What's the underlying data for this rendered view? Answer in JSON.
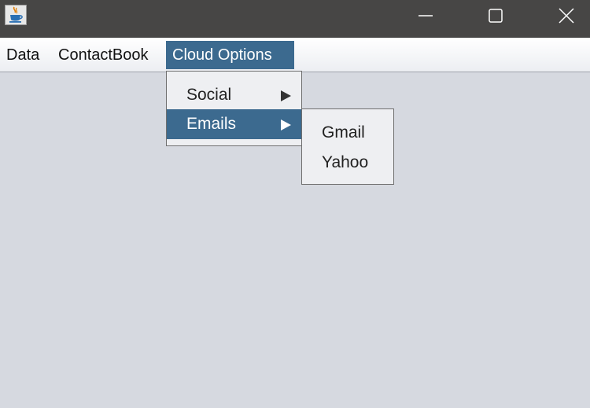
{
  "window": {
    "app_icon": "java-coffee-cup-icon",
    "controls": [
      "minimize-icon",
      "maximize-icon",
      "close-icon"
    ]
  },
  "menubar": {
    "menus": [
      "Data",
      "ContactBook",
      "Cloud Options"
    ],
    "active_menu": "Cloud Options"
  },
  "cloud_menu": {
    "items": [
      {
        "label": "Social",
        "has_submenu": true
      },
      {
        "label": "Emails",
        "has_submenu": true,
        "highlighted": true
      }
    ]
  },
  "emails_submenu": {
    "items": [
      "Gmail",
      "Yahoo"
    ]
  },
  "colors": {
    "titlebar": "#474645",
    "selection": "#3c6a8f",
    "content_background": "#d6d9e0",
    "menu_background": "#eeeff2"
  }
}
